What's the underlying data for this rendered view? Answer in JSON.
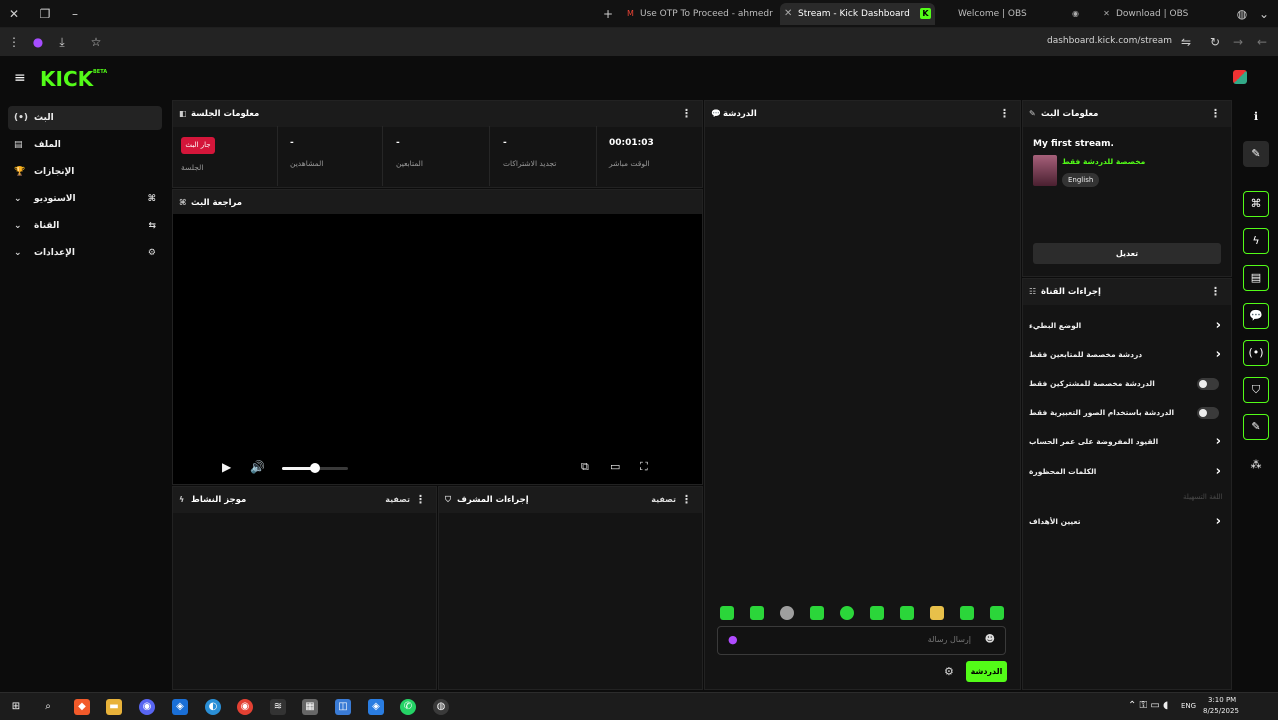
{
  "browser": {
    "tabs": [
      {
        "label": "Use OTP To Proceed - ahmedr",
        "favicon": "M",
        "fav_color": "#ea4335"
      },
      {
        "label": "Stream - Kick Dashboard",
        "favicon": "K",
        "fav_color": "#53fc18",
        "active": true
      },
      {
        "label": "Welcome | OBS",
        "favicon": "◉",
        "fav_color": "#888888"
      },
      {
        "label": "Download | OBS",
        "favicon": "◉",
        "fav_color": "#888888"
      }
    ],
    "url": "dashboard.kick.com/stream"
  },
  "app": {
    "logo": "KICK",
    "logo_badge": "BETA",
    "accent": "#53fc18"
  },
  "sidebar": {
    "items": [
      {
        "label": "البث",
        "icon": "(•)"
      },
      {
        "label": "الملف",
        "icon": "▤"
      },
      {
        "label": "الإنجازات",
        "icon": "🏆"
      },
      {
        "label": "الاستوديو",
        "icon": "⌄",
        "right_icon": "⌘"
      },
      {
        "label": "القناة",
        "icon": "⌄",
        "right_icon": "⇆"
      },
      {
        "label": "الإعدادات",
        "icon": "⌄",
        "right_icon": "⚙"
      }
    ]
  },
  "session": {
    "title": "معلومات الجلسة",
    "live_badge": "جار البث",
    "live_label": "الجلسة",
    "stats": [
      {
        "value": "-",
        "label": "المشاهدين"
      },
      {
        "value": "-",
        "label": "المتابعين"
      },
      {
        "value": "-",
        "label": "تجديد الاشتراكات"
      },
      {
        "value": "00:01:03",
        "label": "الوقت مباشر"
      }
    ]
  },
  "preview": {
    "title": "مراجعة البث",
    "volume_level": 0.5
  },
  "activity": {
    "title": "موجز النشاط",
    "filter": "تصفية"
  },
  "mod_actions": {
    "title": "إجراءات المشرف",
    "filter": "تصفية"
  },
  "chat": {
    "title": "الدردشة",
    "input_placeholder": "إرسال رسالة",
    "send_label": "الدردشة"
  },
  "stream_info": {
    "title": "معلومات البث",
    "stream_title": "My first stream.",
    "category": "مخصصة للدردشة فقط",
    "language": "English",
    "edit_label": "تعديل"
  },
  "channel_actions": {
    "title": "إجراءات القناة",
    "rows": [
      {
        "label": "الوضع البطيء",
        "type": "chevron"
      },
      {
        "label": "دردشة مخصصة للمتابعين فقط",
        "type": "chevron"
      },
      {
        "label": "الدردشة مخصصة للمشتركين فقط",
        "type": "toggle"
      },
      {
        "label": "الدردشة باستخدام الصور التعبيرية فقط",
        "type": "toggle"
      },
      {
        "label": "القيود المفروضة على عمر الحساب",
        "type": "chevron"
      },
      {
        "label": "الكلمات المحظورة",
        "type": "chevron"
      }
    ],
    "muted_label": "اللغة التسهيلة",
    "goals_label": "تعيين الأهداف"
  },
  "taskbar": {
    "lang": "ENG",
    "time": "3:10 PM",
    "date": "8/25/2025"
  }
}
